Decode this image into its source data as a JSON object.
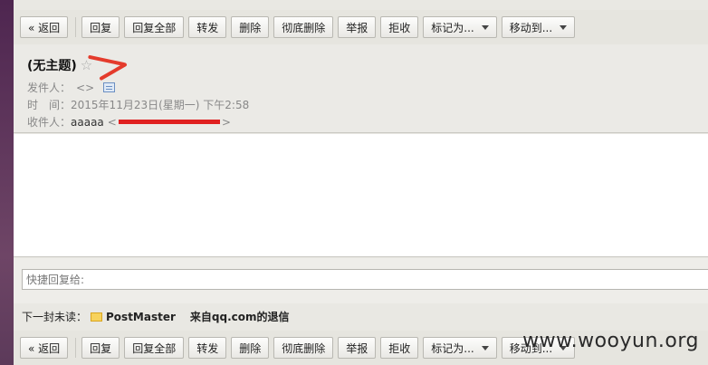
{
  "toolbar": {
    "back": "« 返回",
    "reply": "回复",
    "reply_all": "回复全部",
    "forward": "转发",
    "delete": "删除",
    "delete_permanently": "彻底删除",
    "report": "举报",
    "reject": "拒收",
    "mark_as": "标记为...",
    "move_to": "移动到..."
  },
  "mail": {
    "subject": "(无主题)",
    "from_label": "发件人：",
    "from_value": "<>",
    "time_label": "时　间：",
    "time_value": "2015年11月23日(星期一) 下午2:58",
    "to_label": "收件人：",
    "to_name": "aaaaa",
    "to_open": "<",
    "to_close": ">"
  },
  "quick_reply": {
    "placeholder": "快捷回复给:"
  },
  "next_unread": {
    "label": "下一封未读：",
    "sender": "PostMaster",
    "subject": "来自qq.com的退信"
  },
  "watermark": "www.wooyun.org",
  "colors": {
    "accent_red": "#e43b2c",
    "frame": "#5a2f52"
  }
}
